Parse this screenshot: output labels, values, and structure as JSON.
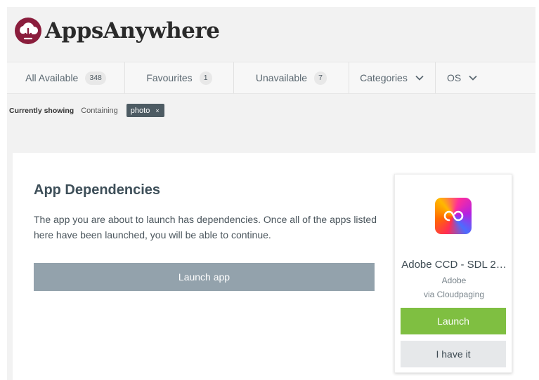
{
  "brand": {
    "name": "AppsAnywhere",
    "logo_icon": "cloud-download-logo-icon",
    "accent_color": "#8a1d3c"
  },
  "nav": {
    "all_available": {
      "label": "All Available",
      "count": "348"
    },
    "favourites": {
      "label": "Favourites",
      "count": "1"
    },
    "unavailable": {
      "label": "Unavailable",
      "count": "7"
    },
    "categories": {
      "label": "Categories",
      "icon": "chevron-down-icon"
    },
    "os": {
      "label": "OS",
      "icon": "chevron-down-icon"
    }
  },
  "filter": {
    "label": "Currently showing",
    "containing": "Containing",
    "chip": "photo",
    "chip_remove": "×"
  },
  "dialog": {
    "title": "App Dependencies",
    "description": "The app you are about to launch has dependencies. Once all of the apps listed here have been launched, you will be able to continue.",
    "launch_app_label": "Launch app",
    "launch_app_color": "#93a2ac"
  },
  "dependency_card": {
    "app_icon": "creative-cloud-icon",
    "app_name": "Adobe CCD - SDL 2…",
    "publisher": "Adobe",
    "delivery": "via Cloudpaging",
    "launch_label": "Launch",
    "launch_color": "#7fbf41",
    "have_it_label": "I have it"
  }
}
